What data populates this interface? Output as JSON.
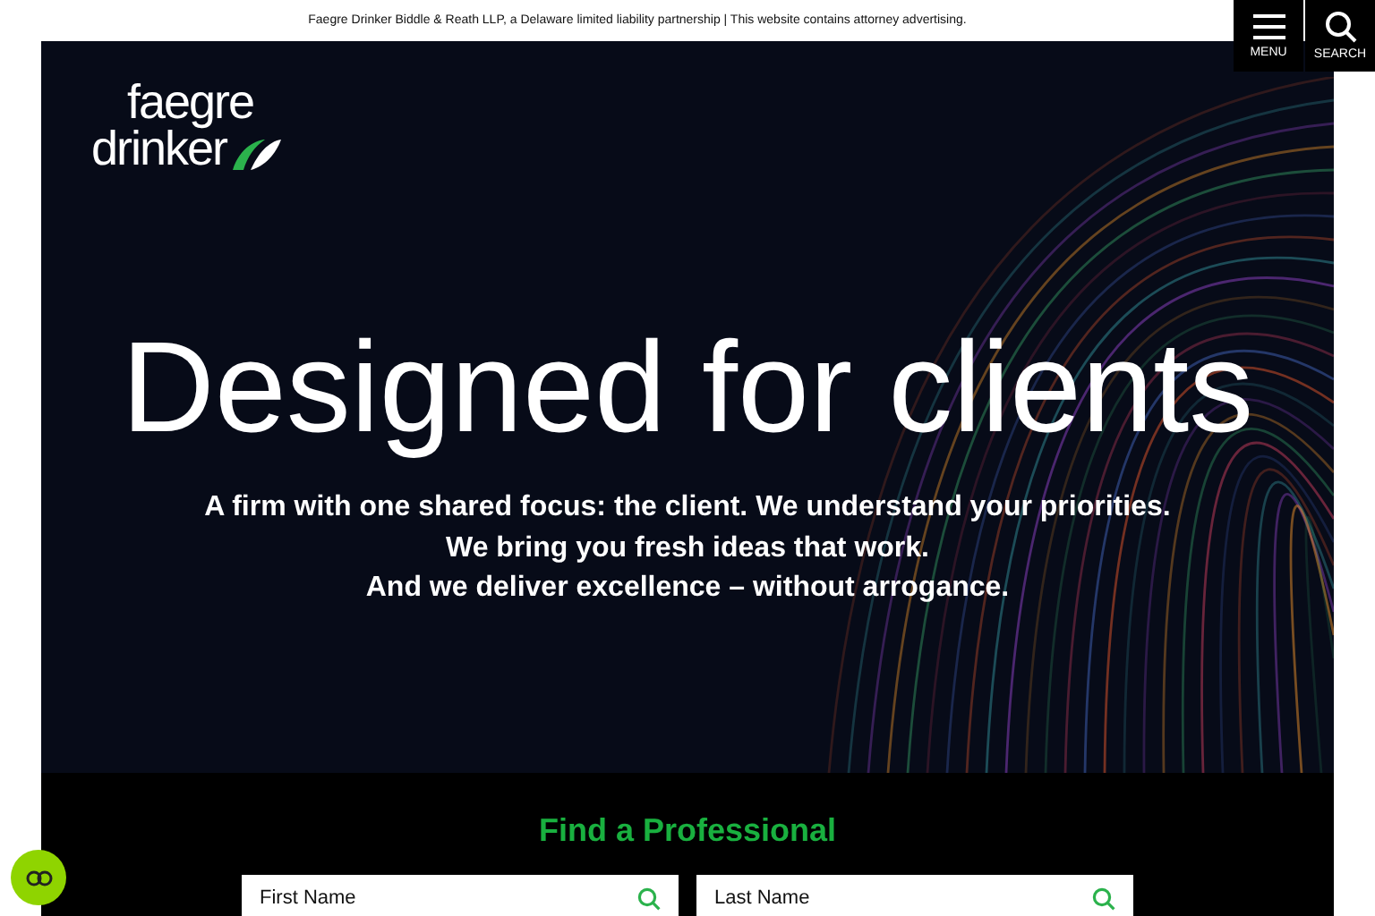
{
  "disclaimer": "Faegre Drinker Biddle & Reath LLP, a Delaware limited liability partnership | This website contains attorney advertising.",
  "header_buttons": [
    {
      "kind": "menu",
      "label": "MENU"
    },
    {
      "kind": "search",
      "label": "SEARCH"
    }
  ],
  "logo": {
    "line_1": "faegre",
    "line_2": "drinker"
  },
  "hero": {
    "title": "Designed for clients",
    "lines": [
      "A firm with one shared focus: the client. We understand your priorities.",
      "We bring you fresh ideas that work.",
      "And we deliver excellence – without arrogance."
    ]
  },
  "find_professional": {
    "title": "Find a Professional",
    "fields": [
      {
        "placeholder": "First Name"
      },
      {
        "placeholder": "Last Name"
      }
    ]
  }
}
